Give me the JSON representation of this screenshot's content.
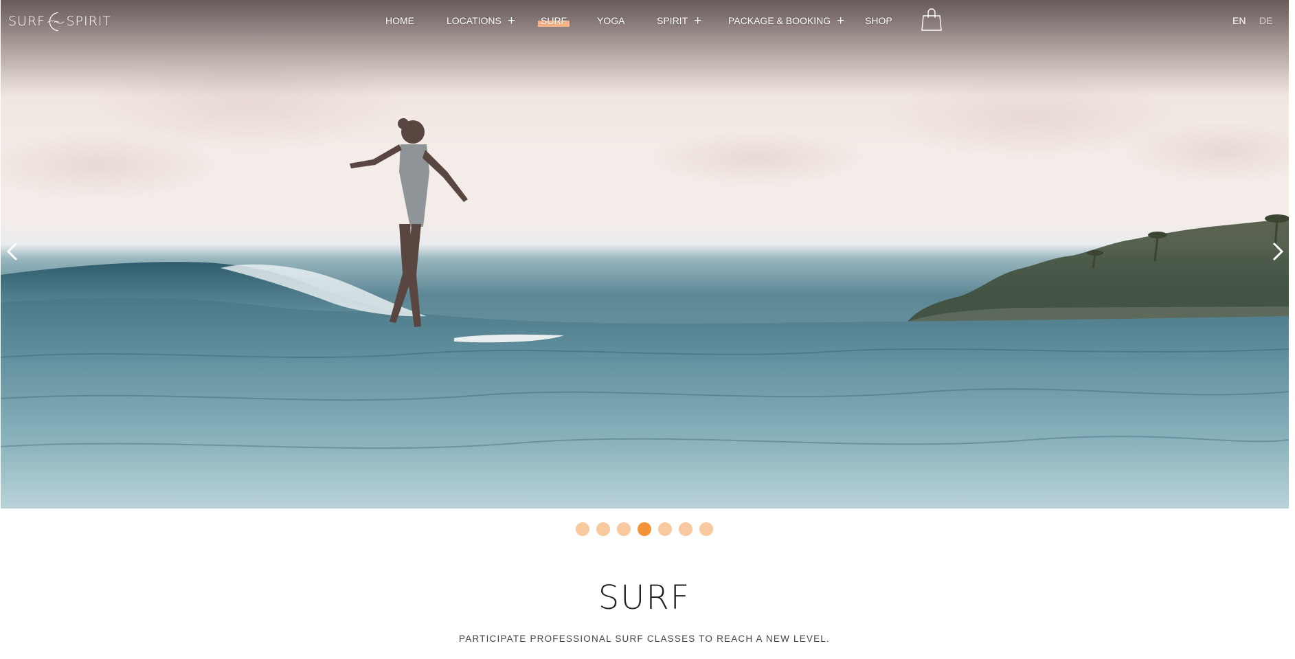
{
  "logo": {
    "left": "SURF",
    "right": "SPIRIT"
  },
  "nav": {
    "items": [
      {
        "label": "HOME",
        "has_submenu": false
      },
      {
        "label": "LOCATIONS",
        "has_submenu": true
      },
      {
        "label": "SURF",
        "has_submenu": false,
        "active": true
      },
      {
        "label": "YOGA",
        "has_submenu": false
      },
      {
        "label": "SPIRIT",
        "has_submenu": true
      },
      {
        "label": "PACKAGE & BOOKING",
        "has_submenu": true
      },
      {
        "label": "SHOP",
        "has_submenu": false
      }
    ],
    "submenu_symbol": "+",
    "cart_icon": "shopping-bag-icon"
  },
  "language": {
    "options": [
      "EN",
      "DE"
    ],
    "selected": "EN"
  },
  "slider": {
    "slide_count": 7,
    "active_slide": 4,
    "prev_icon": "chevron-left-icon",
    "next_icon": "chevron-right-icon"
  },
  "section": {
    "title": "SURF",
    "subtitle": "PARTICIPATE PROFESSIONAL SURF CLASSES TO REACH A NEW LEVEL."
  },
  "colors": {
    "accent": "#f7b285",
    "dot_active": "#f29338",
    "dot_inactive": "#f8c89f",
    "title_text": "#222222"
  }
}
